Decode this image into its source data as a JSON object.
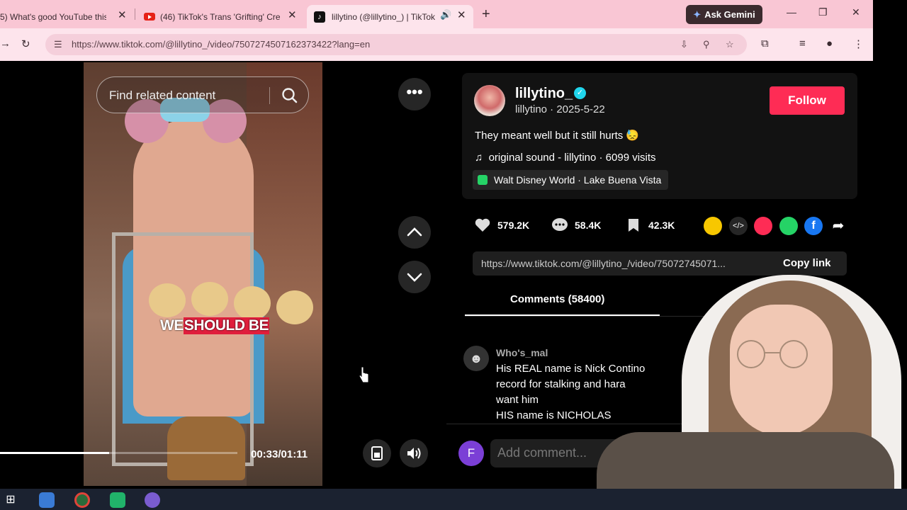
{
  "browser": {
    "tabs": [
      {
        "title": "5) What's good YouTube this",
        "icon": "youtube-icon"
      },
      {
        "title": "(46) TikTok's Trans 'Grifting' Cre",
        "icon": "youtube-icon"
      },
      {
        "title": "lillytino (@lillytino_) | TikTok",
        "icon": "tiktok-icon"
      }
    ],
    "ask_gemini": "Ask Gemini",
    "url": "https://www.tiktok.com/@lillytino_/video/7507274507162373422?lang=en"
  },
  "video": {
    "search_placeholder": "Find related content",
    "caption_before": "WE ",
    "caption_highlight": "SHOULD BE",
    "timecode": "00:33/01:11",
    "progress": 0.46
  },
  "post": {
    "username": "lillytino_",
    "subline": "lillytino · 2025-5-22",
    "follow_label": "Follow",
    "description": "They meant well but it still hurts 😓",
    "sound": "original sound - lillytino · 6099 visits",
    "location": "Walt Disney World · Lake Buena Vista",
    "likes": "579.2K",
    "comments": "58.4K",
    "saves": "42.3K",
    "share_link": "https://www.tiktok.com/@lillytino_/video/75072745071...",
    "copy_link": "Copy link",
    "comments_tab": "Comments (58400)"
  },
  "comment": {
    "author": "Who's_mal",
    "lines": [
      "His REAL name is Nick Contino",
      "record for stalking and hara",
      "want him",
      "HIS name is NICHOLAS"
    ]
  },
  "composer": {
    "avatar_letter": "F",
    "placeholder": "Add comment..."
  },
  "colors": {
    "accent": "#fe2c55",
    "chrome": "#f9c6d4",
    "verified": "#20d5ec"
  }
}
